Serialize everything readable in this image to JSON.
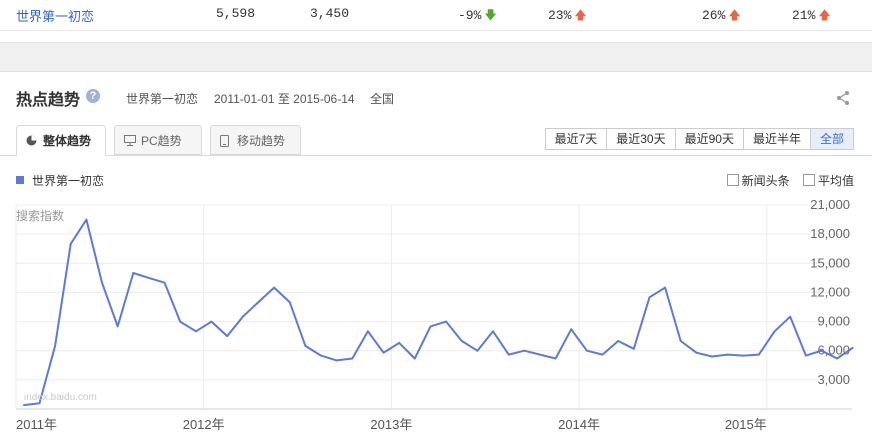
{
  "summary_row": {
    "keyword": "世界第一初恋",
    "val1": "5,598",
    "val2": "3,450",
    "pct1": "-9%",
    "pct2": "23%",
    "pct3": "26%",
    "pct4": "21%",
    "down_icon": "arrow-down-icon",
    "up_icon": "arrow-up-icon"
  },
  "section": {
    "title": "热点趋势",
    "help_icon": "question-icon",
    "keyword": "世界第一初恋",
    "date_range": "2011-01-01 至 2015-06-14",
    "region": "全国",
    "share_icon": "share-icon"
  },
  "tabs": [
    {
      "label": "整体趋势",
      "icon": "pie-icon"
    },
    {
      "label": "PC趋势",
      "icon": "monitor-icon"
    },
    {
      "label": "移动趋势",
      "icon": "phone-icon"
    }
  ],
  "range_buttons": [
    "最近7天",
    "最近30天",
    "最近90天",
    "最近半年",
    "全部"
  ],
  "legend": {
    "series_name": "世界第一初恋",
    "color": "#5d7bd5"
  },
  "options": {
    "news": "新闻头条",
    "avg": "平均值"
  },
  "watermark": "index.baidu.com",
  "chart_data": {
    "type": "line",
    "ylabel": "搜索指数",
    "ylim": [
      0,
      21000
    ],
    "yticks": [
      "3,000",
      "6,000",
      "9,000",
      "12,000",
      "15,000",
      "18,000",
      "21,000"
    ],
    "xticks": [
      "2011年",
      "2012年",
      "2013年",
      "2014年",
      "2015年"
    ],
    "series": [
      {
        "name": "世界第一初恋",
        "x": [
          "2011-01",
          "2011-02",
          "2011-03",
          "2011-04",
          "2011-05",
          "2011-06",
          "2011-07",
          "2011-08",
          "2011-09",
          "2011-10",
          "2011-11",
          "2011-12",
          "2012-01",
          "2012-02",
          "2012-03",
          "2012-04",
          "2012-05",
          "2012-06",
          "2012-07",
          "2012-08",
          "2012-09",
          "2012-10",
          "2012-11",
          "2012-12",
          "2013-01",
          "2013-02",
          "2013-03",
          "2013-04",
          "2013-05",
          "2013-06",
          "2013-07",
          "2013-08",
          "2013-09",
          "2013-10",
          "2013-11",
          "2013-12",
          "2014-01",
          "2014-02",
          "2014-03",
          "2014-04",
          "2014-05",
          "2014-06",
          "2014-07",
          "2014-08",
          "2014-09",
          "2014-10",
          "2014-11",
          "2014-12",
          "2015-01",
          "2015-02",
          "2015-03",
          "2015-04",
          "2015-05",
          "2015-06"
        ],
        "values": [
          400,
          600,
          6500,
          17000,
          19500,
          13000,
          8500,
          14000,
          13500,
          13000,
          9000,
          8000,
          9000,
          7500,
          9500,
          11000,
          12500,
          11000,
          6500,
          5500,
          5000,
          5200,
          8000,
          5800,
          6800,
          5200,
          8500,
          9000,
          7000,
          6000,
          8000,
          5600,
          6000,
          5600,
          5200,
          8200,
          6000,
          5600,
          7000,
          6200,
          11500,
          12500,
          7000,
          5800,
          5400,
          5600,
          5500,
          5600,
          8000,
          9500,
          5500,
          6000,
          5200,
          6300
        ]
      }
    ]
  }
}
